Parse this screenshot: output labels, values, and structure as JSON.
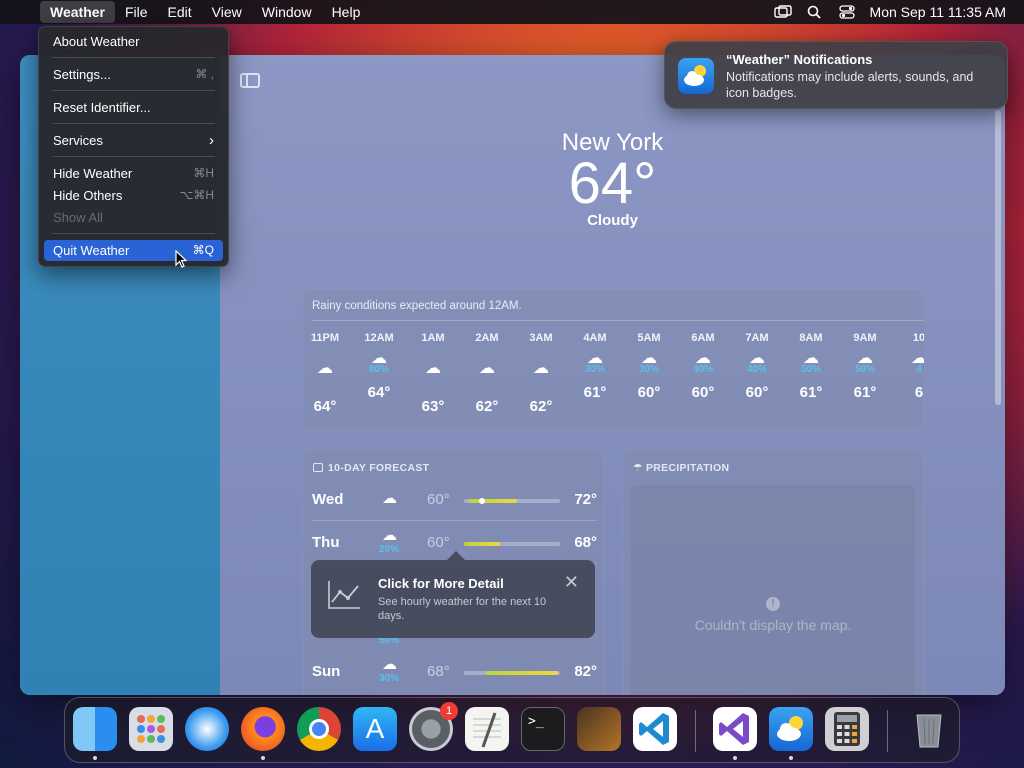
{
  "menubar": {
    "apple_glyph": "",
    "items": [
      "Weather",
      "File",
      "Edit",
      "View",
      "Window",
      "Help"
    ],
    "clock": "Mon Sep 11  11:35 AM"
  },
  "app_menu": {
    "items": [
      {
        "label": "About Weather",
        "shortcut": ""
      },
      {
        "label": "Settings...",
        "shortcut": "⌘ ,"
      },
      {
        "label": "Reset Identifier...",
        "shortcut": ""
      },
      {
        "label": "Services",
        "shortcut": "›"
      },
      {
        "label": "Hide Weather",
        "shortcut": "⌘H"
      },
      {
        "label": "Hide Others",
        "shortcut": "⌥⌘H"
      },
      {
        "label": "Show All",
        "shortcut": ""
      },
      {
        "label": "Quit Weather",
        "shortcut": "⌘Q"
      }
    ]
  },
  "notification": {
    "title": "“Weather” Notifications",
    "body": "Notifications may include alerts, sounds, and icon badges."
  },
  "weather": {
    "city": "New York",
    "temp": "64°",
    "condition": "Cloudy"
  },
  "hourly": {
    "summary": "Rainy conditions expected around 12AM.",
    "hours": [
      {
        "label": "11PM",
        "pct": "",
        "temp": "64°",
        "icon": "cloud-icon"
      },
      {
        "label": "12AM",
        "pct": "80%",
        "temp": "64°",
        "icon": "rain-cloud-icon"
      },
      {
        "label": "1AM",
        "pct": "",
        "temp": "63°",
        "icon": "cloud-icon"
      },
      {
        "label": "2AM",
        "pct": "",
        "temp": "62°",
        "icon": "cloud-icon"
      },
      {
        "label": "3AM",
        "pct": "",
        "temp": "62°",
        "icon": "cloud-icon"
      },
      {
        "label": "4AM",
        "pct": "30%",
        "temp": "61°",
        "icon": "rain-cloud-icon"
      },
      {
        "label": "5AM",
        "pct": "30%",
        "temp": "60°",
        "icon": "rain-cloud-icon"
      },
      {
        "label": "6AM",
        "pct": "40%",
        "temp": "60°",
        "icon": "rain-cloud-icon"
      },
      {
        "label": "7AM",
        "pct": "40%",
        "temp": "60°",
        "icon": "rain-cloud-icon"
      },
      {
        "label": "8AM",
        "pct": "50%",
        "temp": "61°",
        "icon": "rain-cloud-icon"
      },
      {
        "label": "9AM",
        "pct": "50%",
        "temp": "61°",
        "icon": "rain-cloud-icon"
      },
      {
        "label": "10",
        "pct": "4",
        "temp": "6",
        "icon": "rain-cloud-icon"
      }
    ]
  },
  "ten_day": {
    "title": "10-DAY FORECAST",
    "rows": [
      {
        "day": "Wed",
        "pct": "",
        "lo": "60°",
        "hi": "72°",
        "range": [
          0.05,
          0.55
        ],
        "current": 0.18
      },
      {
        "day": "Thu",
        "pct": "20%",
        "lo": "60°",
        "hi": "68°",
        "range": [
          0.0,
          0.38
        ]
      },
      {
        "day": "Sun",
        "pct": "30%",
        "lo": "68°",
        "hi": "82°",
        "range": [
          0.22,
          0.98
        ]
      }
    ],
    "partial_row": {
      "pct": "50%"
    }
  },
  "precipitation": {
    "title": "PRECIPITATION",
    "message": "Couldn't display the map."
  },
  "tooltip": {
    "title": "Click for More Detail",
    "body": "See hourly weather for the next 10 days."
  },
  "dock": {
    "items": [
      "Finder",
      "Launchpad",
      "Safari",
      "Firefox",
      "Chrome",
      "App Store",
      "System Settings",
      "TextEdit",
      "Terminal",
      "GarageBand",
      "VS Code",
      "Visual Studio",
      "Weather",
      "Calculator",
      "Trash"
    ],
    "settings_badge": "1"
  }
}
